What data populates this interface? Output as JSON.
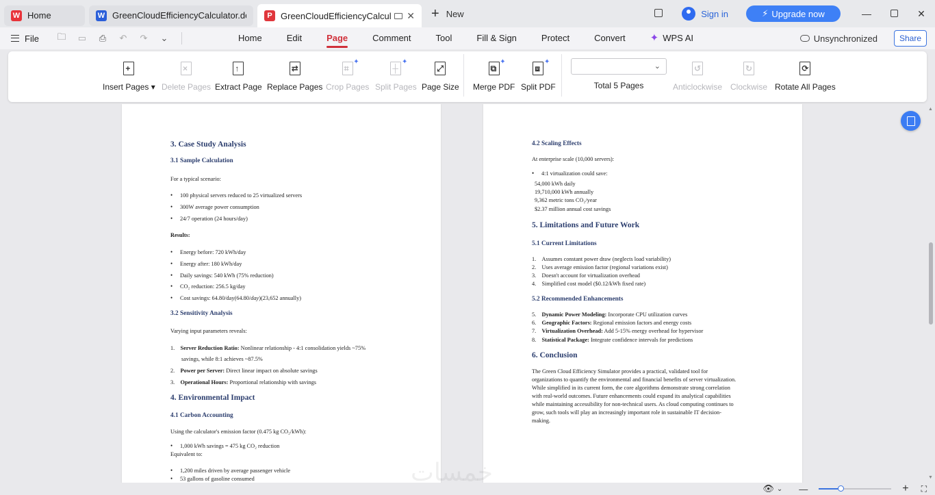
{
  "tabs": [
    {
      "label": "Home",
      "icon": "wps-logo-icon"
    },
    {
      "label": "GreenCloudEfficiencyCalculator.docx",
      "icon": "word-doc-icon"
    },
    {
      "label": "GreenCloudEfficiencyCalculator.pdf",
      "icon": "pdf-doc-icon"
    }
  ],
  "new_tab_label": "New",
  "sign_in_label": "Sign in",
  "upgrade_label": "Upgrade now",
  "menu": {
    "file_label": "File",
    "tabs": [
      "Home",
      "Edit",
      "Page",
      "Comment",
      "Tool",
      "Fill & Sign",
      "Protect",
      "Convert"
    ],
    "active_tab": "Page",
    "wps_ai_label": "WPS AI",
    "unsync_label": "Unsynchronized",
    "share_label": "Share"
  },
  "ribbon": {
    "insert_pages": "Insert Pages",
    "delete_pages": "Delete Pages",
    "extract_page": "Extract Page",
    "replace_pages": "Replace Pages",
    "crop_pages": "Crop Pages",
    "split_pages": "Split Pages",
    "page_size": "Page Size",
    "merge_pdf": "Merge PDF",
    "split_pdf": "Split PDF",
    "page_select_value": "",
    "total_pages": "Total 5 Pages",
    "anticlockwise": "Anticlockwise",
    "clockwise": "Clockwise",
    "rotate_all": "Rotate All Pages"
  },
  "left_page": {
    "h_case": "3. Case Study Analysis",
    "h_sample": "3.1 Sample Calculation",
    "typical": "For a typical scenario:",
    "b1": "100 physical servers reduced to 25 virtualized servers",
    "b2": "300W average power consumption",
    "b3": "24/7 operation (24 hours/day)",
    "results": "Results:",
    "r1": "Energy before: 720 kWh/day",
    "r2": "Energy after: 180 kWh/day",
    "r3": "Daily savings: 540 kWh (75% reduction)",
    "r4": "CO₂ reduction: 256.5 kg/day",
    "r5_a": "Cost savings: 64.80/day(64.80/",
    "r5_b": "day",
    "r5_c": ")(23,652  annually)",
    "h_sens": "3.2 Sensitivity Analysis",
    "varying": "Varying input parameters reveals:",
    "s1_num": "1.",
    "s1_bold": "Server Reduction Ratio:",
    "s1_text": " Nonlinear relationship - 4:1  consolidation yields ~75%",
    "s1_cont": "savings, while 8:1 achieves  ~87.5%",
    "s2_num": "2.",
    "s2_bold": "Power per Server:",
    "s2_text": " Direct linear impact on absolute savings",
    "s3_num": "3.",
    "s3_bold": "Operational Hours:",
    "s3_text": " Proportional relationship with savings",
    "h_env": "4. Environmental Impact",
    "h_carbon": "4.1 Carbon Accounting",
    "using": "Using the calculator's emission factor (0.475 kg CO₂/kWh):",
    "c1": "1,000  kWh savings = 475 kg CO₂ reduction",
    "equiv": "Equivalent to:",
    "e1": "1,200  miles driven by average passenger vehicle",
    "e2": "53 gallons of gasoline consumed"
  },
  "right_page": {
    "h_scaling": "4.2 Scaling Effects",
    "enterprise": "At enterprise scale (10,000 servers):",
    "v1": "4:1 virtualization could save:",
    "v1a": "54,000  kWh daily",
    "v1b": "19,710,000  kWh annually",
    "v1c": "9,362 metric tons CO₂/year",
    "v1d": "$2.37 million annual cost savings",
    "h_limits": "5. Limitations and Future Work",
    "h_current": "5.1 Current Limitations",
    "l1": "Assumes constant power draw (neglects load variability)",
    "l2": "Uses average emission factor (regional variations exist)",
    "l3": "Doesn't account for virtualization overhead",
    "l4": "Simplified cost model ($0.12/kWh fixed rate)",
    "h_recommended": "5.2 Recommended Enhancements",
    "n5_bold": "Dynamic Power Modeling:",
    "n5_text": " Incorporate CPU utilization curves",
    "n6_bold": "Geographic Factors:",
    "n6_text": " Regional emission factors and energy costs",
    "n7_bold": "Virtualization Overhead:",
    "n7_text": " Add 5-15% energy overhead for hypervisor",
    "n8_bold": "Statistical Package:",
    "n8_text": " Integrate confidence intervals for predictions",
    "h_conclusion": "6. Conclusion",
    "p1": "The Green Cloud Efficiency Simulator provides a practical, validated tool for",
    "p2": "organizations to quantify the environmental and financial benefits of server virtualization.",
    "p3": "While simplified in its current form, the core algorithms demonstrate strong correlation",
    "p4": "with real-world outcomes. Future enhancements could expand its analytical capabilities",
    "p5": "while maintaining accessibility for non-technical users. As cloud computing continues to",
    "p6": "grow, such tools will play an increasingly important role in sustainable IT decision-",
    "p7": "making."
  },
  "watermark": "خمسات",
  "status": {
    "zoom_fraction": 0.3
  },
  "colors": {
    "accent_red": "#d0303a",
    "heading_blue": "#2c3e6e",
    "upgrade_blue": "#3e80f6",
    "link_blue": "#2a64d8"
  }
}
